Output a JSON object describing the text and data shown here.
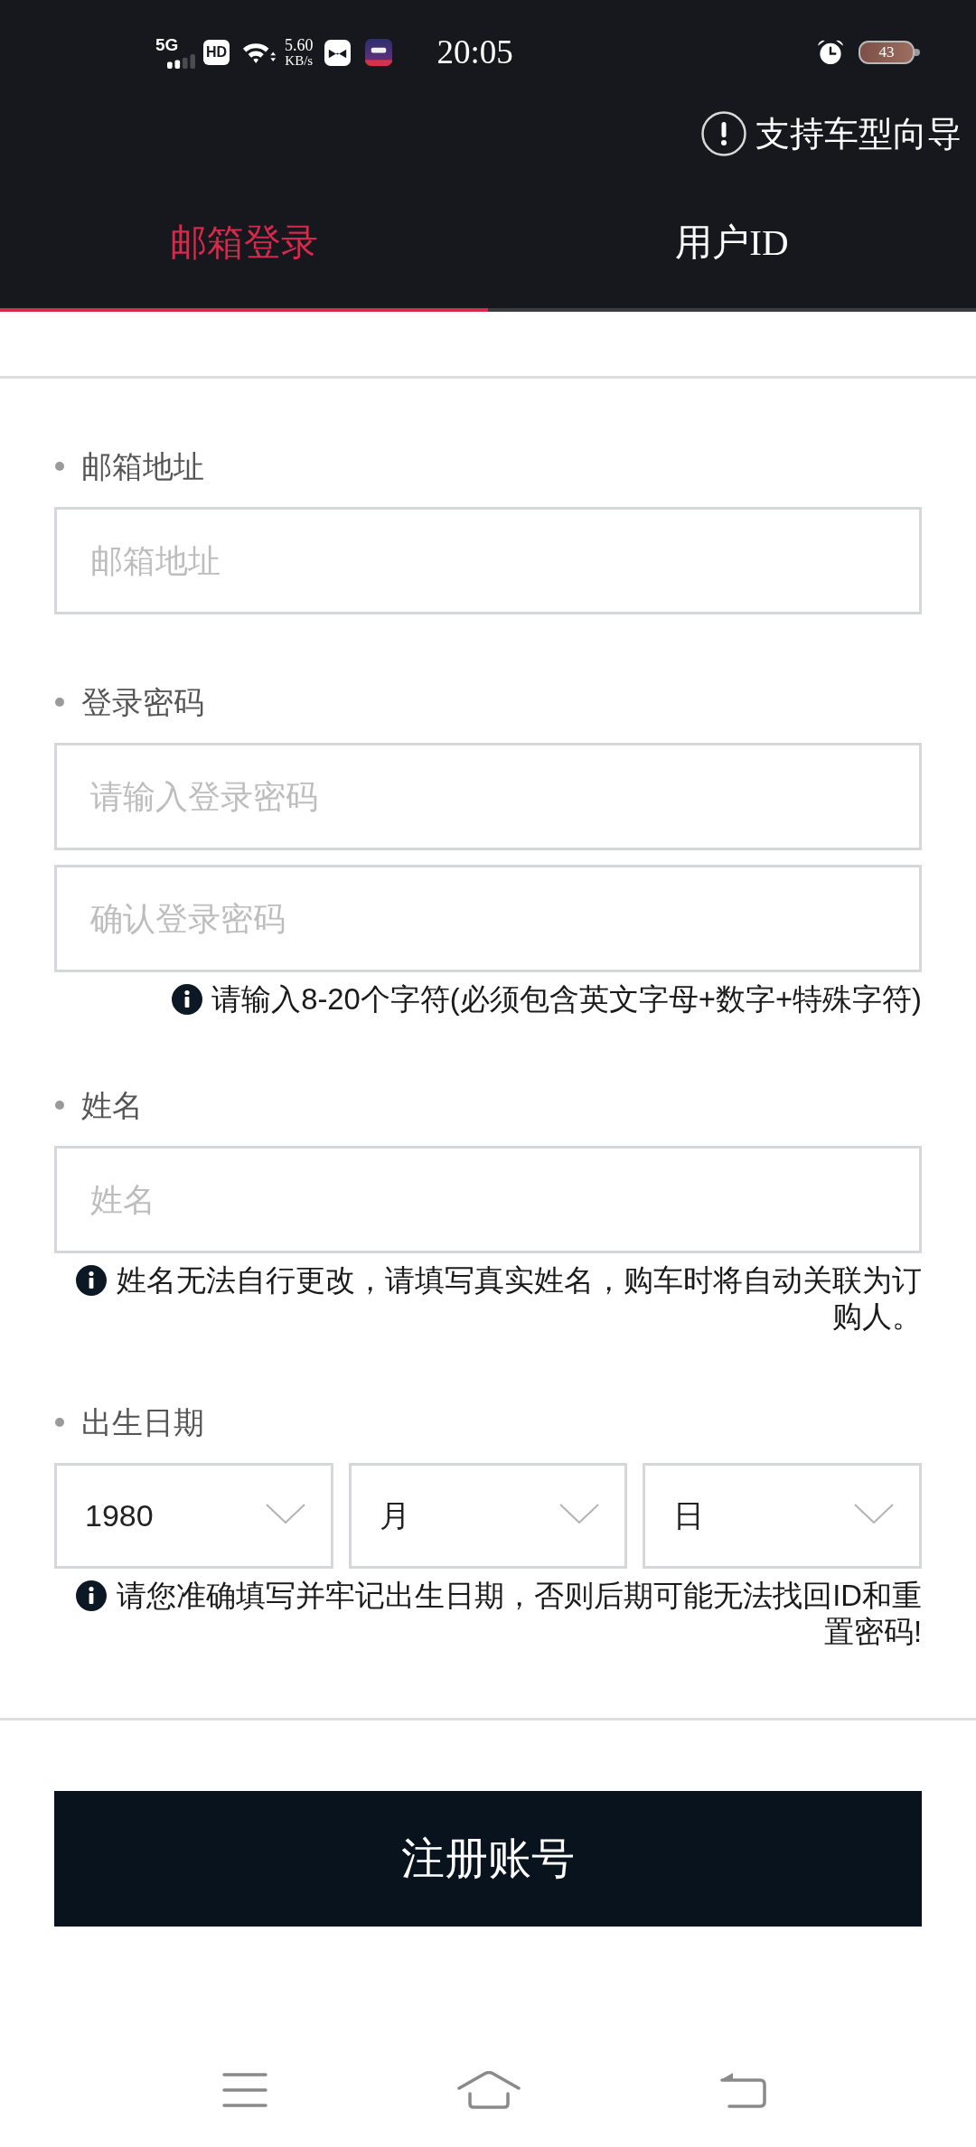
{
  "status_bar": {
    "network": "5G",
    "hd": "HD",
    "speed": "5.60",
    "speed_unit": "KB/s",
    "time": "20:05",
    "battery": "43"
  },
  "guide_link": "支持车型向导",
  "tabs": [
    {
      "label": "邮箱登录",
      "selected": true
    },
    {
      "label": "用户ID",
      "selected": false
    }
  ],
  "sections": [
    {
      "label": "邮箱地址",
      "fields": [
        {
          "kind": "input",
          "placeholder": "邮箱地址"
        }
      ]
    },
    {
      "label": "登录密码",
      "fields": [
        {
          "kind": "input",
          "placeholder": "请输入登录密码"
        },
        {
          "kind": "input",
          "placeholder": "确认登录密码"
        }
      ],
      "hint": "请输入8-20个字符(必须包含英文字母+数字+特殊字符)"
    },
    {
      "label": "姓名",
      "fields": [
        {
          "kind": "input",
          "placeholder": "姓名"
        }
      ],
      "hint": "姓名无法自行更改，请填写真实姓名，购车时将自动关联为订购人。"
    },
    {
      "label": "出生日期",
      "fields": [
        {
          "kind": "select",
          "value": "1980"
        },
        {
          "kind": "select",
          "value": "月"
        },
        {
          "kind": "select",
          "value": "日"
        }
      ],
      "hint": "请您准确填写并牢记出生日期，否则后期可能无法找回ID和重置密码!"
    }
  ],
  "submit_button": "注册账号"
}
